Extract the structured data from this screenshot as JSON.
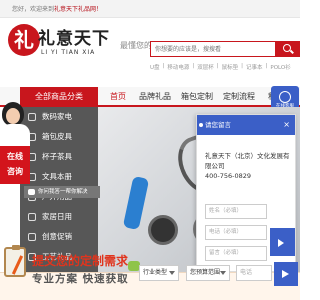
{
  "topbar": {
    "welcome": "您好，欢迎来到",
    "welcome_link": "礼意天下礼品网！"
  },
  "header": {
    "slogan": "最懂您的礼品网",
    "search_placeholder": "你想要的应该是，搜搜看",
    "hotwords": [
      "U盘",
      "移动电源",
      "双层杯",
      "鼠标垫",
      "记事本",
      "POLO衫"
    ]
  },
  "nav": {
    "category": "全部商品分类",
    "items": [
      "首页",
      "品牌礼品",
      "箱包定制",
      "定制流程",
      "积分"
    ]
  },
  "sidebar": {
    "items": [
      "数码家电",
      "箱包皮具",
      "杯子茶具",
      "文具本册",
      "户外用品",
      "家居日用",
      "创意促销",
      "工艺礼品"
    ]
  },
  "service": {
    "online": [
      "在线",
      "咨询"
    ],
    "ask_strip": "你问我答一帮你解决"
  },
  "float_button": {
    "label": "在线客服"
  },
  "dialog": {
    "title": "请您留言",
    "close": "×",
    "company": "礼意天下（北京）文化发展有限公司",
    "phone": "400-756-0829",
    "field1": "姓名（必填）",
    "field2": "电话（必填）",
    "field3": "留言（必填）"
  },
  "bottom": {
    "title": "提交您的定制需求",
    "subtitle": "专业方案  快速获取",
    "select1": "行业类型",
    "select2": "您预算范围",
    "select3": "电话"
  },
  "colors": {
    "brand_red": "#c8161d",
    "accent_blue": "#3b5fc7"
  }
}
